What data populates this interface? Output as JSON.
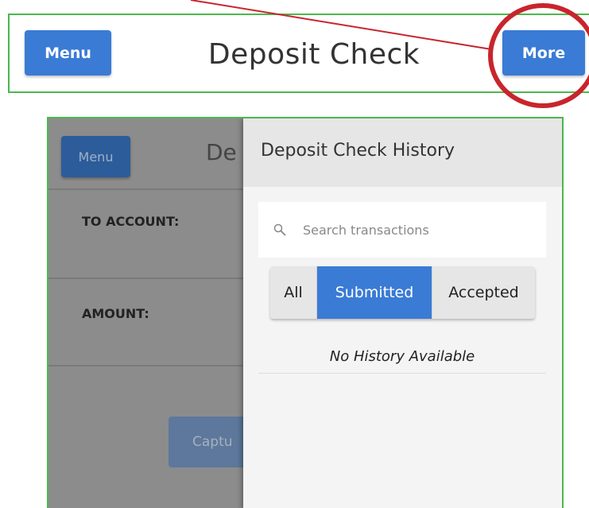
{
  "top": {
    "menu_label": "Menu",
    "title": "Deposit Check",
    "more_label": "More"
  },
  "background_screen": {
    "menu_label": "Menu",
    "title_fragment": "De",
    "to_account_label": "TO ACCOUNT:",
    "amount_label": "AMOUNT:",
    "capture_fragment": "Captu"
  },
  "drawer": {
    "title": "Deposit Check History",
    "search": {
      "placeholder": "Search transactions",
      "value": ""
    },
    "filters": [
      {
        "label": "All",
        "active": false
      },
      {
        "label": "Submitted",
        "active": true
      },
      {
        "label": "Accepted",
        "active": false
      }
    ],
    "empty_message": "No History Available"
  },
  "colors": {
    "accent_blue": "#3a7bd5",
    "annotation_red": "#c8252c",
    "frame_green": "#4cb84c"
  },
  "icons": {
    "search": "search-icon"
  }
}
